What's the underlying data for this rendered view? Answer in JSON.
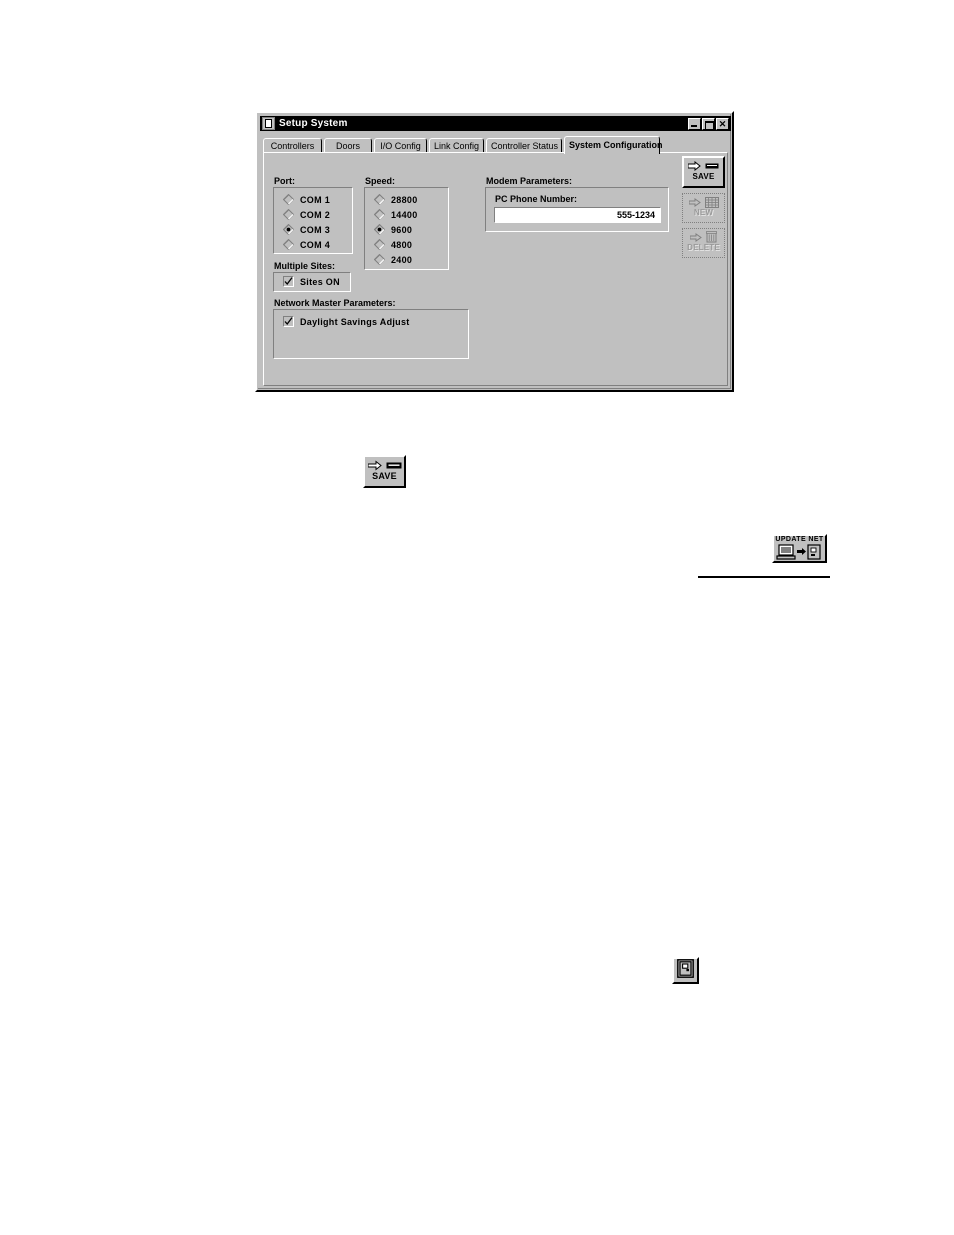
{
  "window": {
    "title": "Setup System",
    "sysmenu_icon": "window-menu-icon",
    "minimize_label": "_",
    "maximize_label": "□",
    "close_label": "✕"
  },
  "tabs": [
    {
      "label": "Controllers",
      "selected": false
    },
    {
      "label": "Doors",
      "selected": false
    },
    {
      "label": "I/O Config",
      "selected": false
    },
    {
      "label": "Link Config",
      "selected": false
    },
    {
      "label": "Controller Status",
      "selected": false
    },
    {
      "label": "System Configuration",
      "selected": true
    }
  ],
  "port_group": {
    "label": "Port:",
    "options": [
      {
        "label": "COM 1",
        "selected": false
      },
      {
        "label": "COM 2",
        "selected": false
      },
      {
        "label": "COM 3",
        "selected": true
      },
      {
        "label": "COM 4",
        "selected": false
      }
    ]
  },
  "speed_group": {
    "label": "Speed:",
    "options": [
      {
        "label": "28800",
        "selected": false
      },
      {
        "label": "14400",
        "selected": false
      },
      {
        "label": "9600",
        "selected": true
      },
      {
        "label": "4800",
        "selected": false
      },
      {
        "label": "2400",
        "selected": false
      }
    ]
  },
  "modem_group": {
    "label": "Modem Parameters:",
    "phone_label": "PC Phone Number:",
    "phone_value": "555-1234",
    "phone_placeholder": ""
  },
  "multiple_sites": {
    "label": "Multiple Sites:",
    "checkbox_label": "Sites ON",
    "checked": true
  },
  "network_master": {
    "label": "Network Master Parameters:",
    "checkbox_label": "Daylight Savings Adjust",
    "checked": true
  },
  "toolbar": {
    "save_label": "SAVE",
    "save_enabled": true,
    "new_label": "NEW",
    "new_enabled": false,
    "delete_label": "DELETE",
    "delete_enabled": false
  },
  "figures": {
    "save_button_label": "SAVE",
    "update_net_label": "UPDATE NET",
    "door_button_icon": "door-icon"
  },
  "colors": {
    "face": "#c0c0c0",
    "shadow": "#808080",
    "highlight": "#ffffff",
    "text": "#000000",
    "disabled_text": "#9a9a9a",
    "titlebar": "#000000",
    "titlebar_text": "#ffffff",
    "field_bg": "#ffffff",
    "page_bg": "#ffffff"
  }
}
